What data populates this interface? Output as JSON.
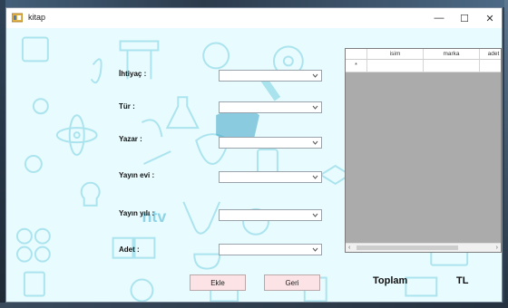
{
  "window": {
    "title": "kitap",
    "minimize_glyph": "—",
    "maximize_glyph": "☐",
    "close_glyph": "✕"
  },
  "form": {
    "fields": [
      {
        "label": "İhtiyaç :",
        "value": ""
      },
      {
        "label": "Tür :",
        "value": ""
      },
      {
        "label": "Yazar :",
        "value": ""
      },
      {
        "label": "Yayın evi :",
        "value": ""
      },
      {
        "label": "Yayın yılı :",
        "value": ""
      },
      {
        "label": "Adet :",
        "value": ""
      }
    ],
    "add_button": "Ekle",
    "back_button": "Geri",
    "total_label": "Toplam",
    "currency_label": "TL"
  },
  "grid": {
    "columns": [
      "isim",
      "marka",
      "adet"
    ],
    "new_row_marker": "*"
  },
  "background": {
    "watermark_text": "ntv"
  }
}
